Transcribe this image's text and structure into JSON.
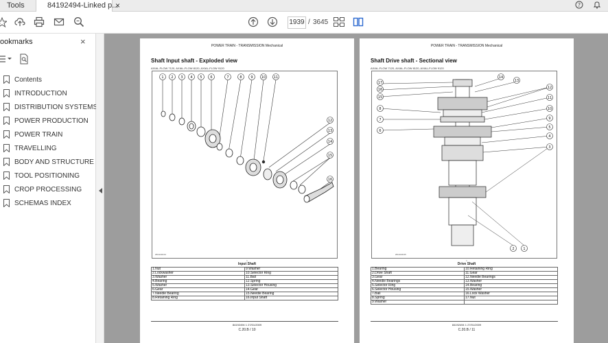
{
  "tabs": {
    "tools": "Tools",
    "document": "84192494-Linked p...",
    "close": "×"
  },
  "toolbar": {
    "current_page": "1939",
    "separator": "/",
    "total_pages": "3645"
  },
  "sidebar": {
    "title": "ookmarks",
    "close": "×",
    "items": [
      {
        "label": "Contents"
      },
      {
        "label": "INTRODUCTION"
      },
      {
        "label": "DISTRIBUTION SYSTEMS"
      },
      {
        "label": "POWER PRODUCTION"
      },
      {
        "label": "POWER TRAIN"
      },
      {
        "label": "TRAVELLING"
      },
      {
        "label": "BODY AND STRUCTURE"
      },
      {
        "label": "TOOL POSITIONING"
      },
      {
        "label": "CROP PROCESSING"
      },
      {
        "label": "SCHEMAS INDEX"
      }
    ]
  },
  "pages": {
    "left": {
      "header": "POWER TRAIN - TRANSMISSION Mechanical",
      "title": "Shaft Input shaft - Exploded view",
      "models": "AXIAL-FLOW 7120, AXIAL-FLOW 8120, AXIAL-FLOW 9120",
      "figure_caption": "Input Shaft",
      "figure_code": "ZDA04644",
      "figure_ref": "1",
      "callouts": [
        "1",
        "2",
        "3",
        "4",
        "5",
        "6",
        "7",
        "8",
        "9",
        "10",
        "11",
        "12",
        "13",
        "14",
        "15",
        "16"
      ],
      "parts": [
        [
          "1.Nut",
          "9.Washer"
        ],
        [
          "2.Lockwasher",
          "10.Selector Ring"
        ],
        [
          "3.Washer",
          "11.Ball"
        ],
        [
          "4.Bearing",
          "12.Spring"
        ],
        [
          "5.Washer",
          "13.Selector Housing"
        ],
        [
          "6.Gear",
          "14.Gear"
        ],
        [
          "7.Needle Bearing",
          "15.Needle Bearing"
        ],
        [
          "8.Retaining Ring",
          "16.Input Shaft"
        ]
      ],
      "footer_doc": "84192494 1 27/01/2009",
      "footer_page": "C.20.B / 10"
    },
    "right": {
      "header": "POWER TRAIN - TRANSMISSION Mechanical",
      "title": "Shaft Drive shaft - Sectional view",
      "models": "AXIAL-FLOW 7120, AXIAL-FLOW 8120, AXIAL-FLOW 9120",
      "figure_caption": "Drive Shaft",
      "figure_code": "ZDA04645",
      "figure_ref": "1",
      "callouts_left": [
        "17",
        "16",
        "15",
        "8",
        "7",
        "6"
      ],
      "callouts_right": [
        "14",
        "13",
        "12",
        "11",
        "10",
        "9",
        "5",
        "4",
        "3"
      ],
      "callouts_bottom": [
        "2",
        "1"
      ],
      "parts": [
        [
          "1.Bearing",
          "10.Retaining Ring"
        ],
        [
          "2.Drive Shaft",
          "11.Gear"
        ],
        [
          "3.Gear",
          "12.Needle Bearings"
        ],
        [
          "4.Needle Bearings",
          "13.Washer"
        ],
        [
          "5.Selector Ring",
          "14.Bearing"
        ],
        [
          "6.Selector Housing",
          "15.Washer"
        ],
        [
          "7.Ball",
          "16.Lock Washer"
        ],
        [
          "8.Spring",
          "17.Nut"
        ],
        [
          "9.Washer",
          ""
        ]
      ],
      "footer_doc": "84192494 1 27/01/2009",
      "footer_page": "C.20.B / 11"
    }
  }
}
